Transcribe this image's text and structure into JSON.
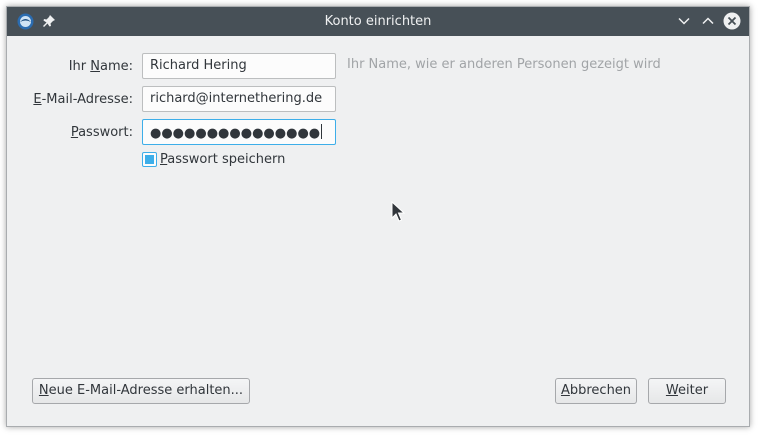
{
  "window": {
    "title": "Konto einrichten"
  },
  "form": {
    "name_label_pre": "Ihr ",
    "name_label_accel": "N",
    "name_label_post": "ame:",
    "name_value": "Richard Hering",
    "name_hint": "Ihr Name, wie er anderen Personen gezeigt wird",
    "email_label_accel": "E",
    "email_label_post": "-Mail-Adresse:",
    "email_value": "richard@internethering.de",
    "password_label_accel": "P",
    "password_label_post": "asswort:",
    "password_value": "●●●●●●●●●●●●●●●",
    "save_password_accel": "P",
    "save_password_post": "asswort speichern",
    "save_password_checked": true
  },
  "buttons": {
    "new_email_accel": "N",
    "new_email_post": "eue E-Mail-Adresse erhalten...",
    "cancel_accel": "A",
    "cancel_post": "bbrechen",
    "next_accel": "W",
    "next_post": "eiter"
  },
  "icons": {
    "app": "thunderbird-icon",
    "pin": "pin-icon",
    "minimize": "chevron-down-icon",
    "maximize": "chevron-up-icon",
    "close": "close-icon"
  },
  "colors": {
    "titlebar": "#475057",
    "accent": "#3daee9",
    "window_bg": "#eff0f1"
  }
}
